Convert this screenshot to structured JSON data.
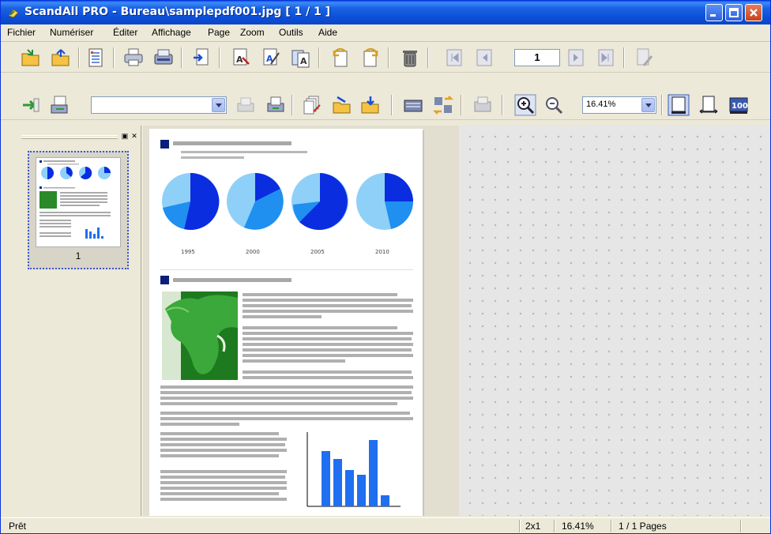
{
  "window": {
    "title": "ScandAll PRO - Bureau\\samplepdf001.jpg  [ 1 / 1 ]"
  },
  "menu": [
    "Fichier",
    "Numériser",
    "Éditer",
    "Affichage",
    "Page",
    "Zoom",
    "Outils",
    "Aide"
  ],
  "toolbar1": {
    "page_number": "1"
  },
  "toolbar2": {
    "profile_select": "",
    "zoom_value": "16.41%"
  },
  "thumbnails": {
    "panel_buttons": [
      "▣",
      "✕"
    ],
    "items": [
      {
        "label": "1"
      }
    ]
  },
  "document": {
    "pie_years": [
      "1995",
      "2000",
      "2005",
      "2010"
    ]
  },
  "status": {
    "message": "Prêt",
    "layout": "2x1",
    "zoom": "16.41%",
    "pages": "1 / 1 Pages"
  },
  "colors": {
    "title_bar": "#0a46c8",
    "chart_dark_blue": "#0a2de0",
    "chart_mid_blue": "#1f8ff0",
    "chart_light_blue": "#8fd0f8"
  },
  "icons": [
    "app-scanner-icon",
    "minimize-icon",
    "maximize-icon",
    "close-icon"
  ]
}
